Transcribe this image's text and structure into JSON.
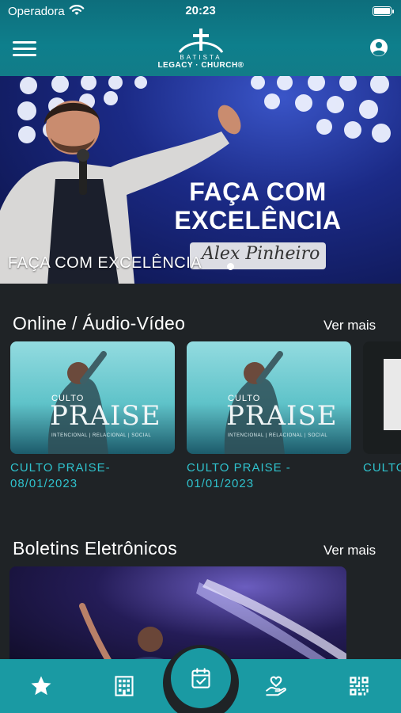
{
  "status_bar": {
    "carrier": "Operadora",
    "time": "20:23"
  },
  "header": {
    "logo_line1": "BATISTA",
    "logo_line2": "LEGACY · CHURCH®"
  },
  "hero": {
    "headline_line1": "FAÇA COM",
    "headline_line2": "EXCELÊNCIA",
    "signature": "Alex Pinheiro",
    "caption": "FAÇA COM EXCELÊNCIA"
  },
  "online_section": {
    "title": "Online / Áudio-Vídeo",
    "see_more": "Ver mais",
    "items": [
      {
        "caption_line1": "CULTO PRAISE-",
        "caption_line2": "08/01/2023",
        "art_small": "CULTO",
        "art_big": "PRAISE",
        "art_sub": "INTENCIONAL | RELACIONAL | SOCIAL"
      },
      {
        "caption_line1": "CULTO PRAISE -",
        "caption_line2": "01/01/2023",
        "art_small": "CULTO",
        "art_big": "PRAISE",
        "art_sub": "INTENCIONAL | RELACIONAL | SOCIAL"
      },
      {
        "caption_line1": "CULTO",
        "caption_line2": ""
      }
    ]
  },
  "bulletins_section": {
    "title": "Boletins Eletrônicos",
    "see_more": "Ver mais"
  },
  "tabbar": {
    "tabs": [
      "star-icon",
      "building-icon",
      "calendar-check-icon",
      "hand-heart-icon",
      "qr-code-icon"
    ],
    "active": "calendar-check-icon"
  },
  "colors": {
    "header": "#0e7f8c",
    "accent": "#1a9aa3",
    "caption": "#2fc2cd",
    "background": "#1f2326"
  }
}
